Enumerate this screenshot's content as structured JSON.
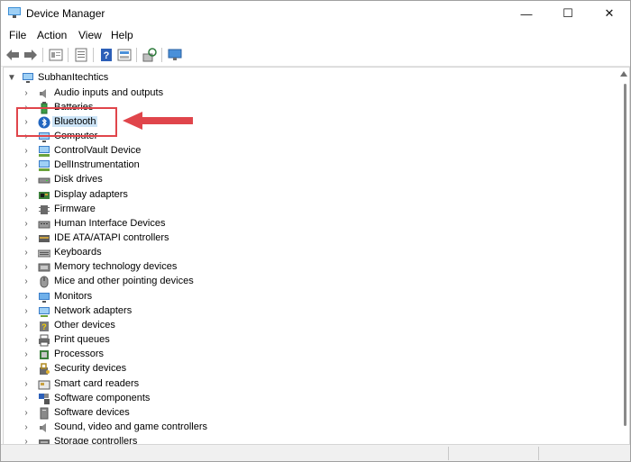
{
  "window": {
    "title": "Device Manager"
  },
  "controls": {
    "minimize": "—",
    "maximize": "☐",
    "close": "✕"
  },
  "menu": [
    "File",
    "Action",
    "View",
    "Help"
  ],
  "toolbar": {
    "buttons": [
      "back-icon",
      "forward-icon",
      "properties-icon",
      "update-driver-icon",
      "help-icon",
      "show-hidden-icon",
      "scan-hardware-icon",
      "monitor-icon"
    ]
  },
  "tree": {
    "root": "SubhanItechtics",
    "items": [
      {
        "label": "Audio inputs and outputs",
        "icon": "speaker-icon"
      },
      {
        "label": "Batteries",
        "icon": "battery-icon"
      },
      {
        "label": "Bluetooth",
        "icon": "bluetooth-icon",
        "selected": true
      },
      {
        "label": "Computer",
        "icon": "computer-icon"
      },
      {
        "label": "ControlVault Device",
        "icon": "network-device-icon"
      },
      {
        "label": "DellInstrumentation",
        "icon": "network-device-icon"
      },
      {
        "label": "Disk drives",
        "icon": "disk-icon"
      },
      {
        "label": "Display adapters",
        "icon": "display-adapter-icon"
      },
      {
        "label": "Firmware",
        "icon": "firmware-icon"
      },
      {
        "label": "Human Interface Devices",
        "icon": "hid-icon"
      },
      {
        "label": "IDE ATA/ATAPI controllers",
        "icon": "ide-icon"
      },
      {
        "label": "Keyboards",
        "icon": "keyboard-icon"
      },
      {
        "label": "Memory technology devices",
        "icon": "memory-icon"
      },
      {
        "label": "Mice and other pointing devices",
        "icon": "mouse-icon"
      },
      {
        "label": "Monitors",
        "icon": "monitor-icon"
      },
      {
        "label": "Network adapters",
        "icon": "network-adapter-icon"
      },
      {
        "label": "Other devices",
        "icon": "unknown-device-icon"
      },
      {
        "label": "Print queues",
        "icon": "printer-icon"
      },
      {
        "label": "Processors",
        "icon": "processor-icon"
      },
      {
        "label": "Security devices",
        "icon": "security-icon"
      },
      {
        "label": "Smart card readers",
        "icon": "smartcard-icon"
      },
      {
        "label": "Software components",
        "icon": "software-component-icon"
      },
      {
        "label": "Software devices",
        "icon": "software-device-icon"
      },
      {
        "label": "Sound, video and game controllers",
        "icon": "speaker-icon"
      },
      {
        "label": "Storage controllers",
        "icon": "storage-icon"
      }
    ]
  },
  "annotation": {
    "color": "#e0454b"
  }
}
